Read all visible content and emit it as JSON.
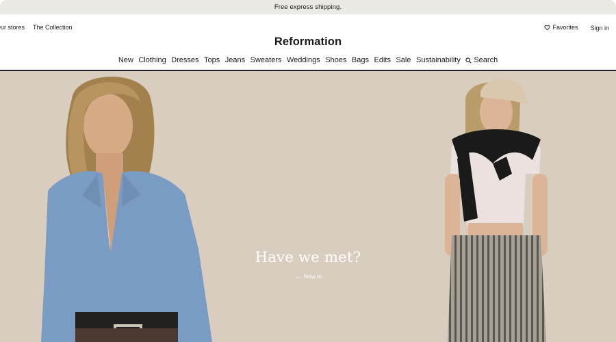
{
  "promo": {
    "text": "Free express shipping."
  },
  "utility_left": {
    "stores": "Our stores",
    "collection": "The Collection"
  },
  "utility_right": {
    "favorites": "Favorites",
    "sign_in": "Sign in"
  },
  "brand": {
    "name": "Reformation"
  },
  "nav": {
    "items": [
      "New",
      "Clothing",
      "Dresses",
      "Tops",
      "Jeans",
      "Sweaters",
      "Weddings",
      "Shoes",
      "Bags",
      "Edits",
      "Sale",
      "Sustainability"
    ],
    "search": "Search"
  },
  "hero": {
    "title": "Have we met?",
    "link": "New in",
    "link_icon": "arrow-right-icon"
  },
  "colors": {
    "promo_bg": "#ebe9e4",
    "hero_bg": "#d9cdbf",
    "sweater_blue": "#7b9cc2",
    "nav_rule": "#1f1a2c"
  }
}
